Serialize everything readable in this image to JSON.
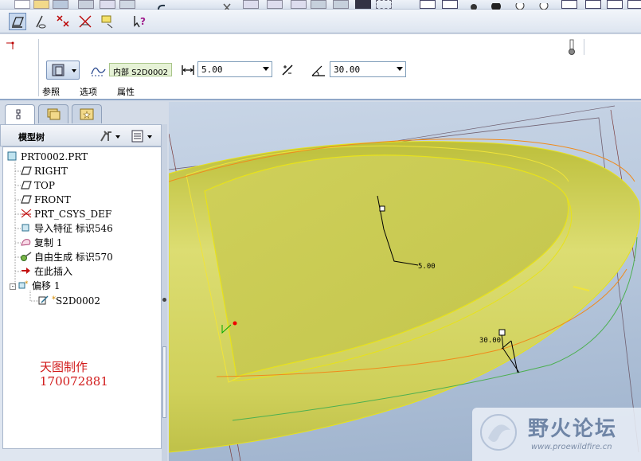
{
  "dashboard": {
    "ref_value": "内部 S2D0002",
    "thickness_value": "5.00",
    "angle_value": "30.00",
    "tabs": [
      "参照",
      "选项",
      "属性"
    ]
  },
  "model_tree": {
    "title": "模型树",
    "items": [
      {
        "label": "PRT0002.PRT",
        "icon": "part-icon"
      },
      {
        "label": "RIGHT",
        "icon": "datum-plane-icon"
      },
      {
        "label": "TOP",
        "icon": "datum-plane-icon"
      },
      {
        "label": "FRONT",
        "icon": "datum-plane-icon"
      },
      {
        "label": "PRT_CSYS_DEF",
        "icon": "csys-icon"
      },
      {
        "label": "导入特征 标识546",
        "icon": "import-feature-icon"
      },
      {
        "label": "复制 1",
        "icon": "copy-surface-icon"
      },
      {
        "label": "自由生成 标识570",
        "icon": "freestyle-icon"
      },
      {
        "label": "在此插入",
        "icon": "insert-here-arrow-icon"
      },
      {
        "label": "偏移 1",
        "icon": "offset-feature-icon"
      },
      {
        "label": "S2D0002",
        "icon": "sketch-icon"
      }
    ]
  },
  "viewport": {
    "dim_thickness": "5.00",
    "dim_angle": "30.00"
  },
  "watermark": {
    "line1": "天图制作",
    "line2": "170072881"
  },
  "logo": {
    "name": "野火论坛",
    "url": "www.proewildfire.cn"
  },
  "colors": {
    "surface": "#cfd05a",
    "surface_edge": "#e8e21a",
    "datum": "#8a6a6a",
    "watermark_text": "#d11a1a"
  }
}
